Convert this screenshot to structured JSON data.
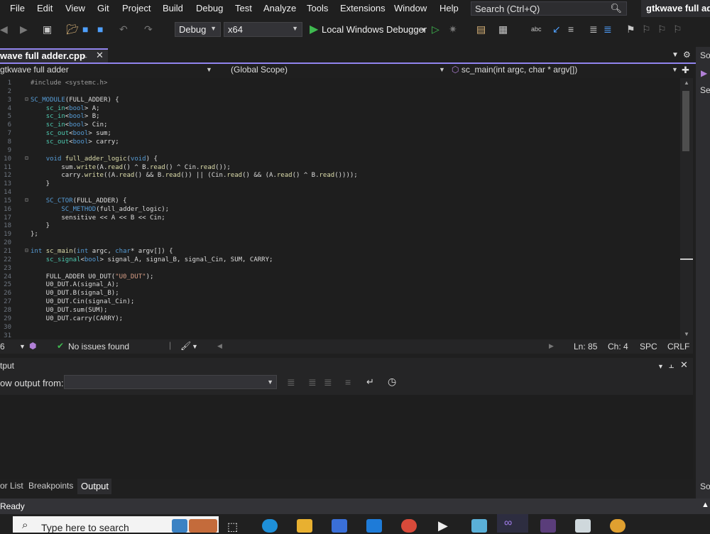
{
  "menu": {
    "items": [
      "File",
      "Edit",
      "View",
      "Git",
      "Project",
      "Build",
      "Debug",
      "Test",
      "Analyze",
      "Tools",
      "Extensions",
      "Window",
      "Help"
    ],
    "search_placeholder": "Search (Ctrl+Q)",
    "window_title": "gtkwave full adder"
  },
  "toolbar": {
    "config": "Debug",
    "platform": "x64",
    "debugger_label": "Local Windows Debugger"
  },
  "tab": {
    "label": "wave full adder.cpp"
  },
  "navbar": {
    "project": "gtkwave full adder",
    "scope": "(Global Scope)",
    "member": "sc_main(int argc, char * argv[])"
  },
  "editor": {
    "lines": [
      {
        "n": "1",
        "t": "#include <systemc.h>"
      },
      {
        "n": "2",
        "t": ""
      },
      {
        "n": "3",
        "t": "SC_MODULE(FULL_ADDER) {"
      },
      {
        "n": "4",
        "t": "    sc_in<bool> A;"
      },
      {
        "n": "5",
        "t": "    sc_in<bool> B;"
      },
      {
        "n": "6",
        "t": "    sc_in<bool> Cin;"
      },
      {
        "n": "7",
        "t": "    sc_out<bool> sum;"
      },
      {
        "n": "8",
        "t": "    sc_out<bool> carry;"
      },
      {
        "n": "9",
        "t": ""
      },
      {
        "n": "10",
        "t": "    void full_adder_logic(void) {"
      },
      {
        "n": "11",
        "t": "        sum.write(A.read() ^ B.read() ^ Cin.read());"
      },
      {
        "n": "12",
        "t": "        carry.write((A.read() && B.read()) || (Cin.read() && (A.read() ^ B.read())));"
      },
      {
        "n": "13",
        "t": "    }"
      },
      {
        "n": "14",
        "t": ""
      },
      {
        "n": "15",
        "t": "    SC_CTOR(FULL_ADDER) {"
      },
      {
        "n": "16",
        "t": "        SC_METHOD(full_adder_logic);"
      },
      {
        "n": "17",
        "t": "        sensitive << A << B << Cin;"
      },
      {
        "n": "18",
        "t": "    }"
      },
      {
        "n": "19",
        "t": "};"
      },
      {
        "n": "20",
        "t": ""
      },
      {
        "n": "21",
        "t": "int sc_main(int argc, char* argv[]) {"
      },
      {
        "n": "22",
        "t": "    sc_signal<bool> signal_A, signal_B, signal_Cin, SUM, CARRY;"
      },
      {
        "n": "23",
        "t": ""
      },
      {
        "n": "24",
        "t": "    FULL_ADDER U0_DUT(\"U0_DUT\");"
      },
      {
        "n": "25",
        "t": "    U0_DUT.A(signal_A);"
      },
      {
        "n": "26",
        "t": "    U0_DUT.B(signal_B);"
      },
      {
        "n": "27",
        "t": "    U0_DUT.Cin(signal_Cin);"
      },
      {
        "n": "28",
        "t": "    U0_DUT.sum(SUM);"
      },
      {
        "n": "29",
        "t": "    U0_DUT.carry(CARRY);"
      },
      {
        "n": "30",
        "t": ""
      },
      {
        "n": "31",
        "t": ""
      }
    ]
  },
  "status": {
    "zoom": "6",
    "issues": "No issues found",
    "line": "Ln: 85",
    "col": "Ch: 4",
    "spacing": "SPC",
    "eol": "CRLF"
  },
  "output": {
    "title": "tput",
    "show_from_label": "ow output from:"
  },
  "bottom_tabs": [
    "or List",
    "Breakpoints",
    "Output"
  ],
  "right_strip": [
    "So",
    "Se",
    "So"
  ],
  "ready": "Ready",
  "taskbar": {
    "search_placeholder": "Type here to search"
  }
}
